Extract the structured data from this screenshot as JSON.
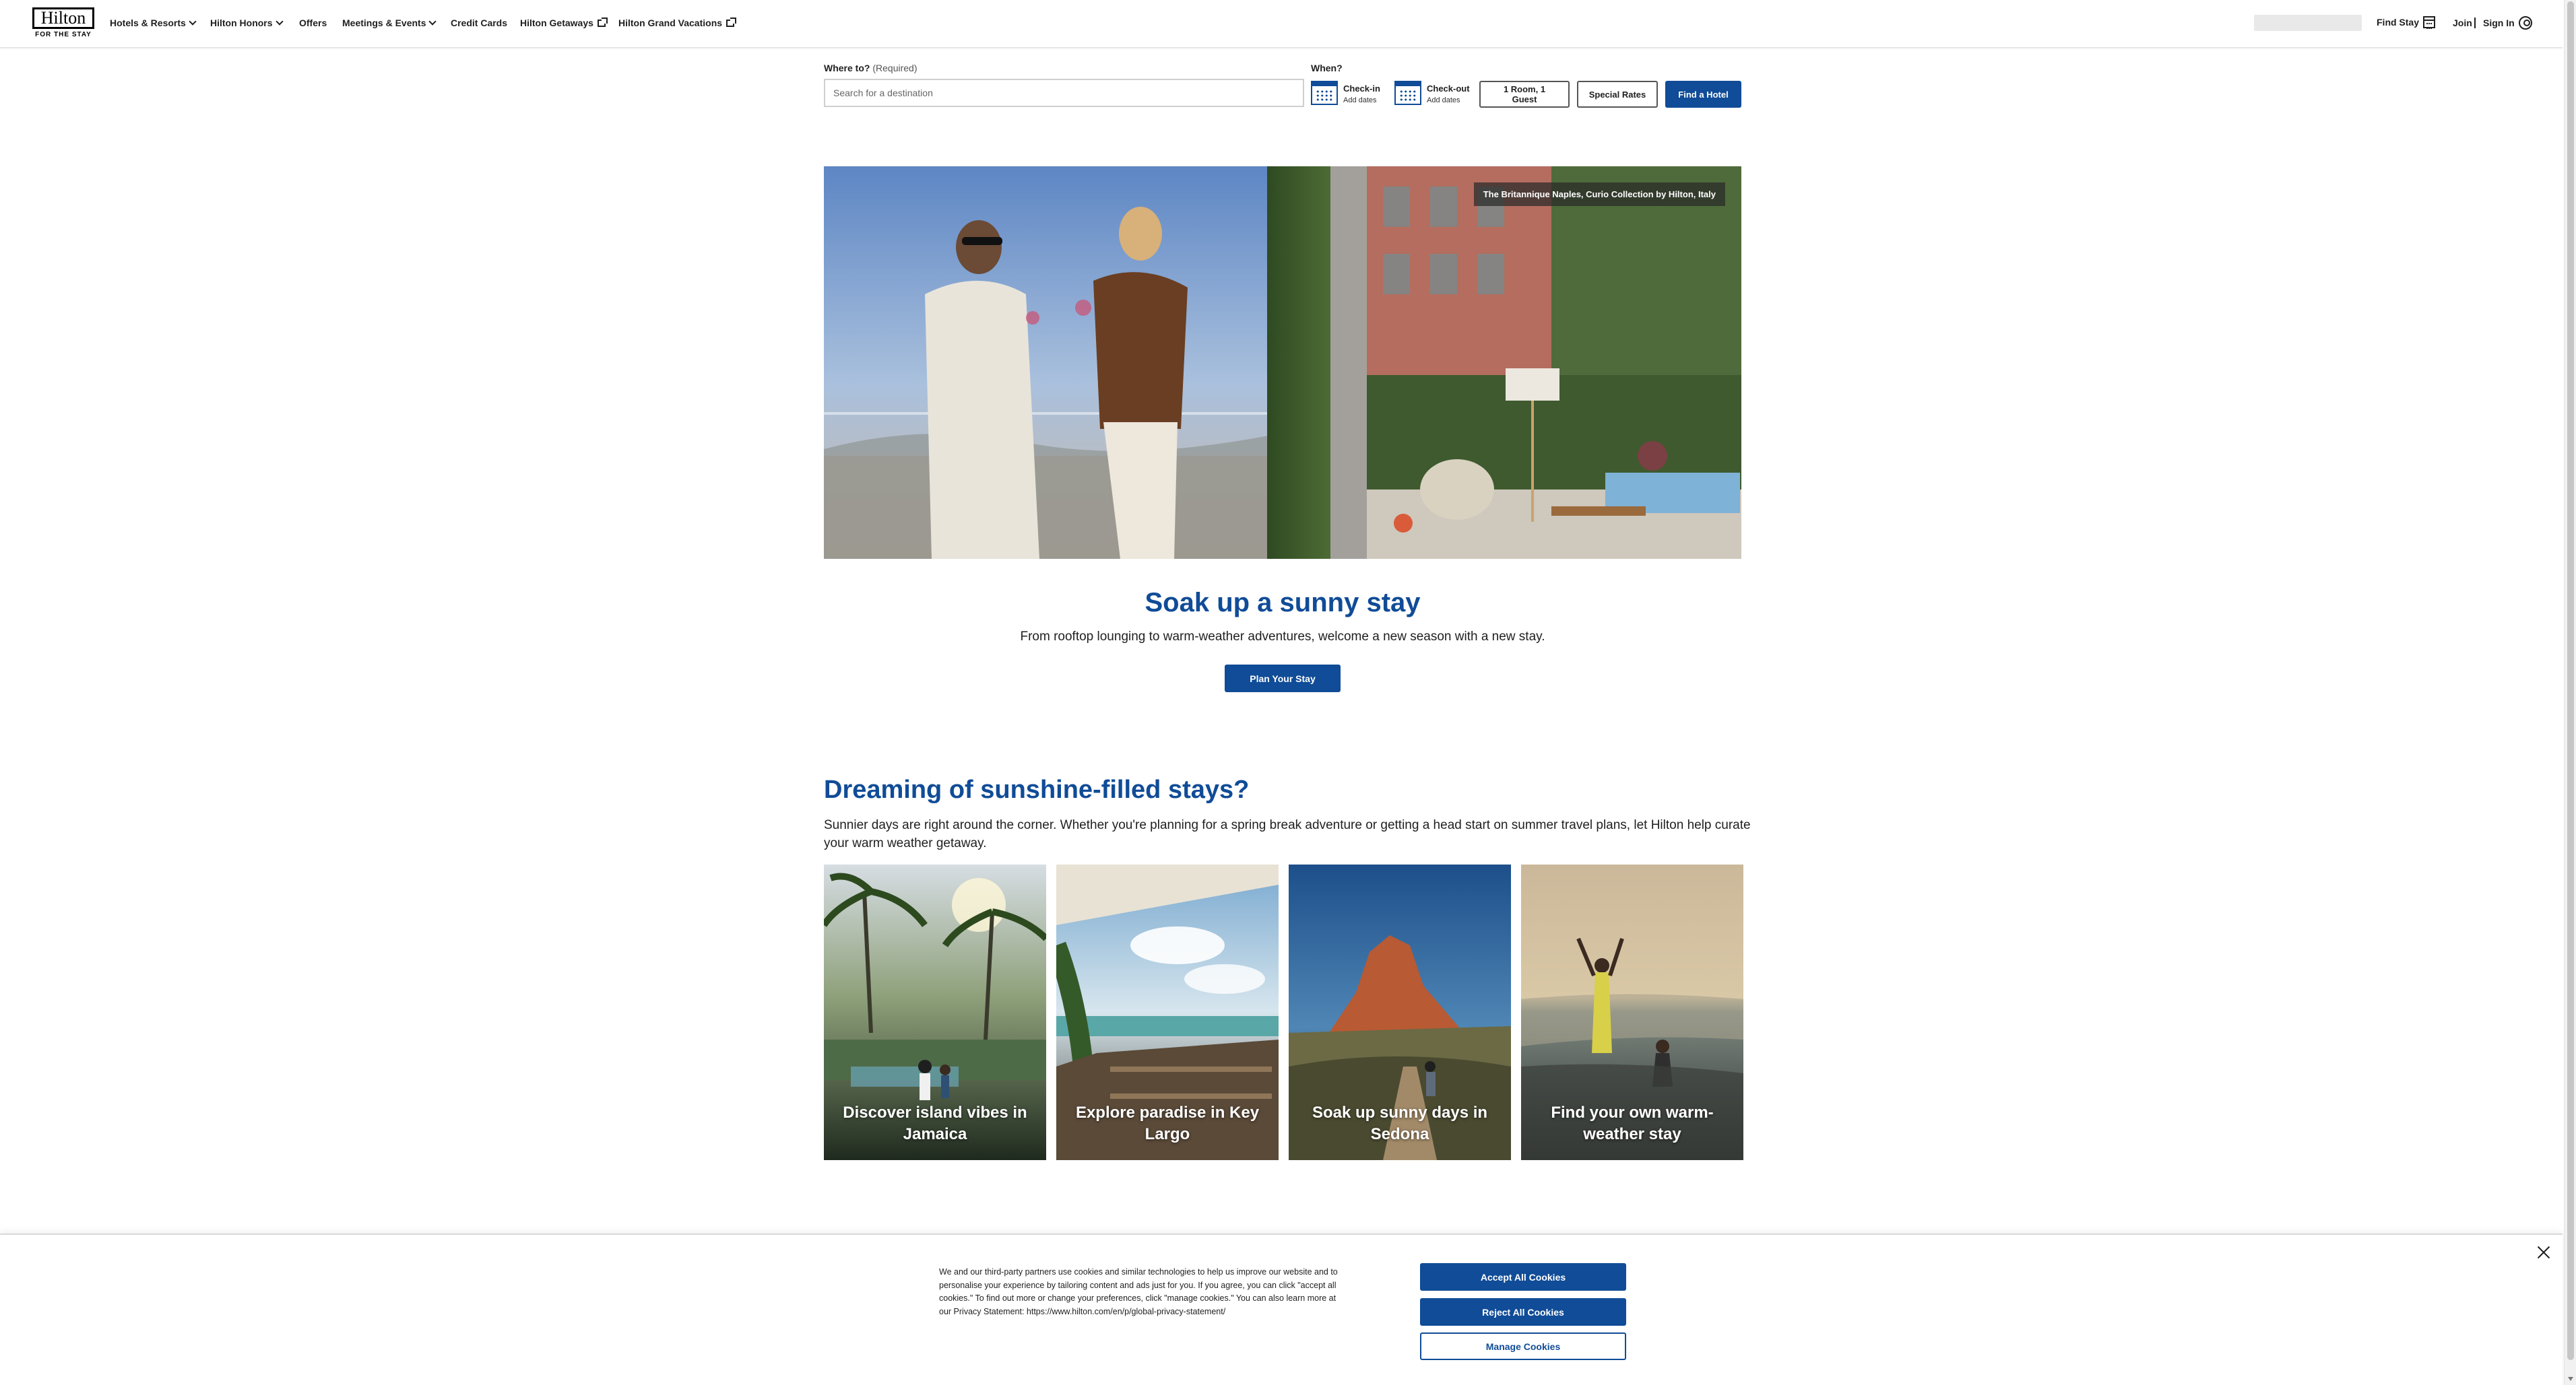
{
  "brand": {
    "name": "Hilton",
    "tagline": "FOR THE STAY"
  },
  "nav": {
    "items": [
      {
        "label": "Hotels & Resorts",
        "icon": "chevron-down-icon"
      },
      {
        "label": "Hilton Honors",
        "icon": "chevron-down-icon"
      },
      {
        "label": "Offers"
      },
      {
        "label": "Meetings & Events",
        "icon": "chevron-down-icon"
      },
      {
        "label": "Credit Cards"
      },
      {
        "label": "Hilton Getaways",
        "icon": "external-link-icon"
      },
      {
        "label": "Hilton Grand Vacations",
        "icon": "external-link-icon"
      }
    ],
    "find_stay": "Find Stay",
    "join": "Join",
    "sign_in": "Sign In"
  },
  "search": {
    "where_label": "Where to?",
    "where_required": "(Required)",
    "placeholder": "Search for a destination",
    "when_label": "When?",
    "checkin_label": "Check-in",
    "checkin_sub": "Add dates",
    "checkout_label": "Check-out",
    "checkout_sub": "Add dates",
    "rooms_guests": "1 Room, 1 Guest",
    "special_rates": "Special Rates",
    "find_button": "Find a Hotel"
  },
  "hero": {
    "caption": "The Britannique Naples, Curio Collection by Hilton, Italy",
    "title": "Soak up a sunny stay",
    "subtitle": "From rooftop lounging to warm-weather adventures, welcome a new season with a new stay.",
    "cta": "Plan Your Stay"
  },
  "section": {
    "title": "Dreaming of sunshine-filled stays?",
    "body": "Sunnier days are right around the corner. Whether you're planning for a spring break adventure or getting a head start on summer travel plans, let Hilton help curate your warm weather getaway.",
    "cards": [
      {
        "title": "Discover island vibes in Jamaica"
      },
      {
        "title": "Explore paradise in Key Largo"
      },
      {
        "title": "Soak up sunny days in Sedona"
      },
      {
        "title": "Find your own warm-weather stay"
      }
    ]
  },
  "cookie": {
    "text": "We and our third-party partners use cookies and similar technologies to help us improve our website and to personalise your experience by tailoring content and ads just for you. If you agree, you can click \"accept all cookies.\" To find out more or change your preferences, click \"manage cookies.\" You can also learn more at our Privacy Statement: https://www.hilton.com/en/p/global-privacy-statement/",
    "accept": "Accept All Cookies",
    "reject": "Reject All Cookies",
    "manage": "Manage Cookies"
  },
  "colors": {
    "brand_blue": "#104c97",
    "text": "#1f1f1f",
    "border": "#cfcfcf"
  }
}
